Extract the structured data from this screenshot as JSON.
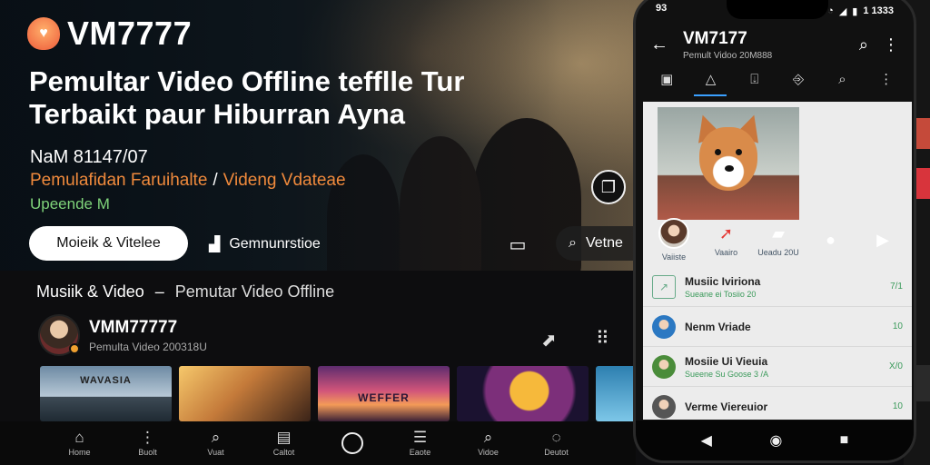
{
  "hero": {
    "logo_text": "VM7777",
    "title_line1": "Pemultar Video Offline tefflle Tur",
    "title_line2": "Terbaikt paur Hiburran Ayna",
    "date": "NaM 81147/07",
    "subtitle_left": "Pemulafidan Faruihalte",
    "subtitle_sep": "/",
    "subtitle_right": "Videng Vdateae",
    "update_label": "Upeende M",
    "primary_button": "Moieik & Vitelee",
    "secondary_button": "Gemnunrstioe",
    "search_label": "Vetne"
  },
  "section": {
    "title": "Musiik & Video",
    "dash": "–",
    "subtitle": "Pemutar Video Offline"
  },
  "channel": {
    "name": "VMM77777",
    "meta": "Pemulta Video 200318U"
  },
  "thumbnails": [
    {
      "label": "WAVASIA"
    },
    {
      "label": ""
    },
    {
      "label": "WEFFER"
    },
    {
      "label": ""
    },
    {
      "label": ""
    }
  ],
  "bottom_nav": [
    {
      "icon": "home-icon",
      "label": "Home"
    },
    {
      "icon": "menu-icon",
      "label": "Buolt"
    },
    {
      "icon": "search-icon",
      "label": "Vuat"
    },
    {
      "icon": "library-icon",
      "label": "Caltot"
    },
    {
      "icon": "circle-icon",
      "label": ""
    },
    {
      "icon": "list-icon",
      "label": "Eaote"
    },
    {
      "icon": "search-icon",
      "label": "Vidoe"
    },
    {
      "icon": "chat-icon",
      "label": "Deutot"
    }
  ],
  "phone": {
    "status_time": "93",
    "status_right": "1 1333",
    "app_title": "VM7177",
    "app_subtitle": "Pemult Vidoo 20M888",
    "actions": [
      {
        "label": "Vaiiste"
      },
      {
        "label": "Vaairo"
      },
      {
        "label": "Ueadu 20U"
      }
    ],
    "list": [
      {
        "title": "Musiic Iviriona",
        "subtitle": "Sueane ei Tosiio 20",
        "trail": "7/1"
      },
      {
        "title": "Nenm Vriade",
        "subtitle": "",
        "trail": "10"
      },
      {
        "title": "Mosiie Ui Vieuia",
        "subtitle": "Sueene Su Goose 3 /A",
        "trail": "X/0"
      },
      {
        "title": "Verme Viereuior",
        "subtitle": "",
        "trail": "10"
      }
    ]
  },
  "colors": {
    "accent_orange": "#f08a3c",
    "accent_green": "#7fd37a",
    "tab_underline": "#3aa0ff"
  }
}
